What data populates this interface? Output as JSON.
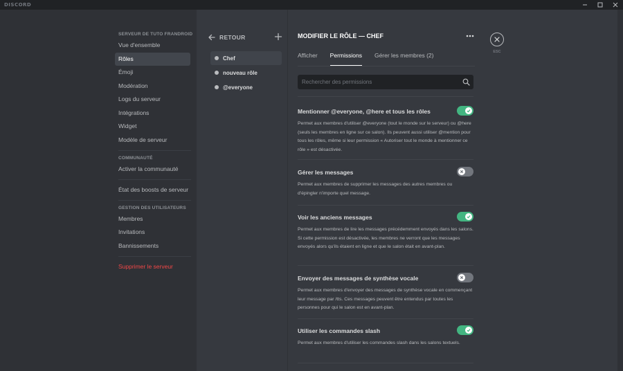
{
  "titlebar": {
    "brand": "DISCORD",
    "controls": [
      "minimize-icon",
      "maximize-icon",
      "close-window-icon"
    ]
  },
  "sidebar": {
    "section1_header": "SERVEUR DE TUTO FRANDROID",
    "section1_items": [
      "Vue d'ensemble",
      "Rôles",
      "Émoji",
      "Modération",
      "Logs du serveur",
      "Intégrations",
      "Widget",
      "Modèle de serveur"
    ],
    "active_item": "Rôles",
    "section2_header": "COMMUNAUTÉ",
    "section2_items": [
      "Activer la communauté"
    ],
    "boost_item": "État des boosts de serveur",
    "section3_header": "GESTION DES UTILISATEURS",
    "section3_items": [
      "Membres",
      "Invitations",
      "Bannissements"
    ],
    "delete_label": "Supprimer le serveur"
  },
  "roles": {
    "back_label": "RETOUR",
    "items": [
      "Chef",
      "nouveau rôle",
      "@everyone"
    ],
    "active": "Chef"
  },
  "main": {
    "title": "MODIFIER LE RÔLE — CHEF",
    "tabs": [
      "Afficher",
      "Permissions",
      "Gérer les membres (2)"
    ],
    "active_tab": "Permissions",
    "search_placeholder": "Rechercher des permissions",
    "permissions": [
      {
        "title": "Mentionner @everyone, @here et tous les rôles",
        "desc": "Permet aux membres d'utiliser @everyone (tout le monde sur le serveur) ou @here (seuls les membres en ligne sur ce salon). Ils peuvent aussi utiliser @mention pour tous les rôles, même si leur permission « Autoriser tout le monde à mentionner ce rôle » est désactivée.",
        "enabled": true
      },
      {
        "title": "Gérer les messages",
        "desc": "Permet aux membres de supprimer les messages des autres membres ou d'épingler n'importe quel message.",
        "enabled": false
      },
      {
        "title": "Voir les anciens messages",
        "desc": "Permet aux membres de lire les messages précédemment envoyés dans les salons. Si cette permission est désactivée, les membres ne verront que les messages envoyés alors qu'ils étaient en ligne et que le salon était en avant-plan.",
        "enabled": true
      },
      {
        "title": "Envoyer des messages de synthèse vocale",
        "desc": "Permet aux membres d'envoyer des messages de synthèse vocale en commençant leur message par /tts. Ces messages peuvent être entendus par toutes les personnes pour qui le salon est en avant-plan.",
        "enabled": false
      },
      {
        "title": "Utiliser les commandes slash",
        "desc": "Permet aux membres d'utiliser les commandes slash dans les salons textuels.",
        "enabled": true
      }
    ]
  },
  "close": {
    "esc_label": "ESC"
  },
  "colors": {
    "accent_green": "#43b581",
    "toggle_off": "#72767d",
    "danger": "#f04747",
    "background": "#36393f",
    "sidebar_bg": "#2f3136"
  }
}
